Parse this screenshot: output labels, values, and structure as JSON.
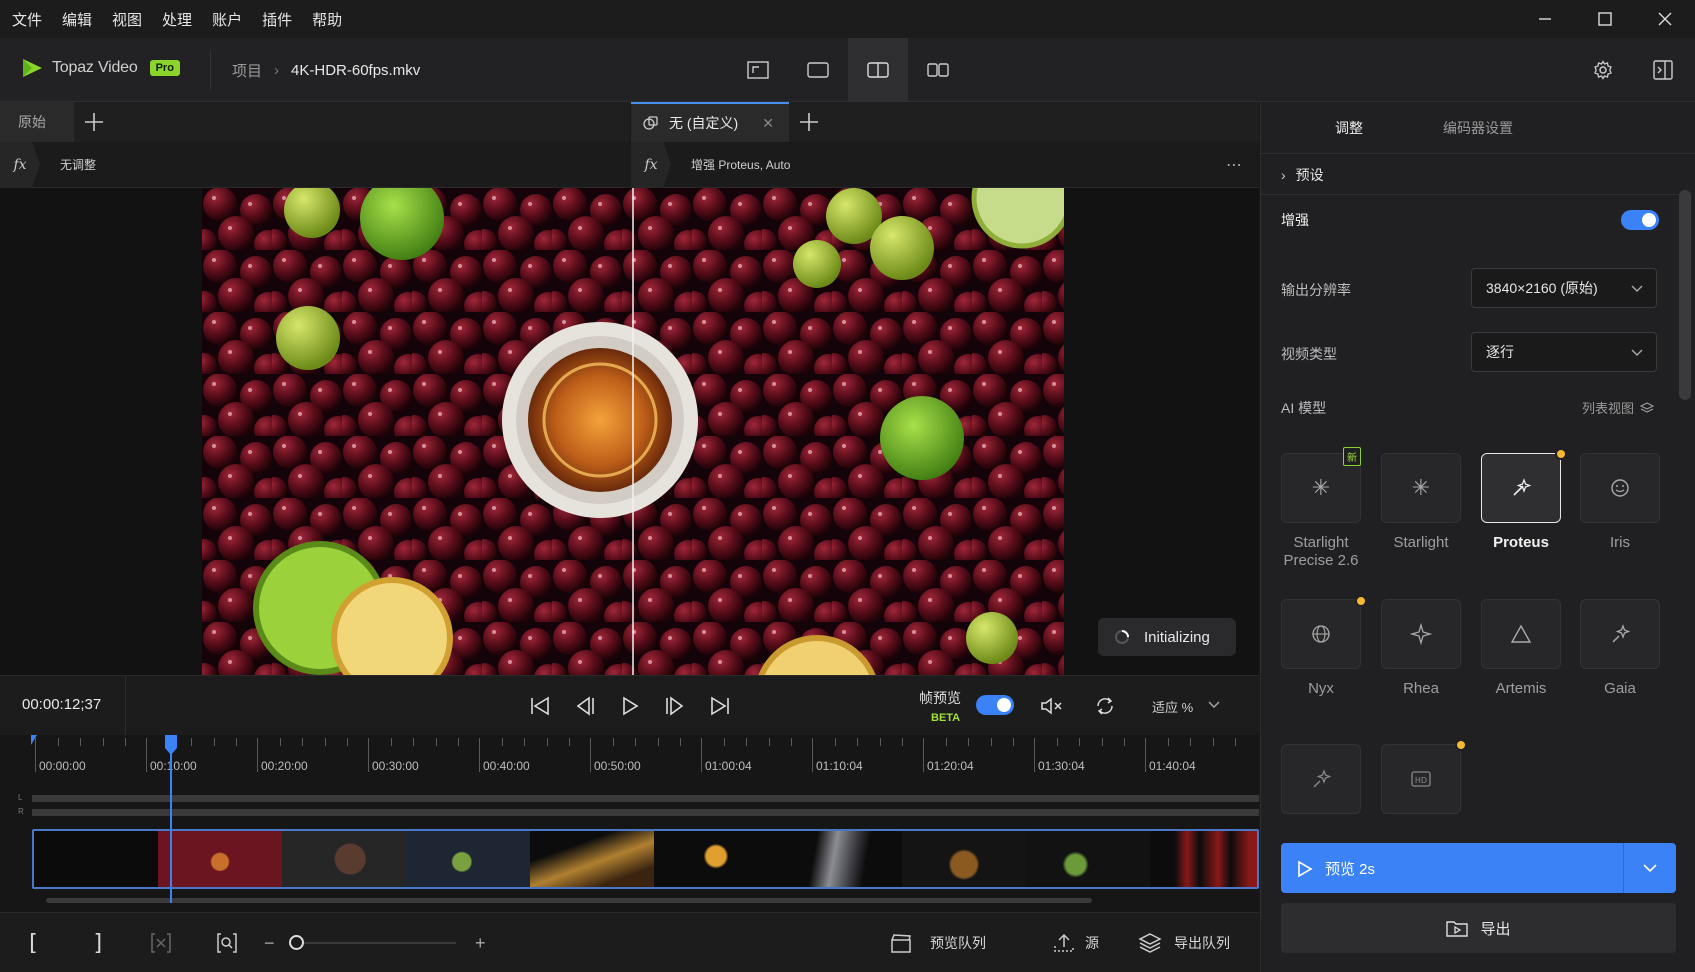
{
  "menu": [
    "文件",
    "编辑",
    "视图",
    "处理",
    "账户",
    "插件",
    "帮助"
  ],
  "app": {
    "brand": "Topaz Video",
    "badge": "Pro"
  },
  "breadcrumb": {
    "project": "项目",
    "file": "4K-HDR-60fps.mkv"
  },
  "left_panel": {
    "tab": "原始",
    "fx_label": "无调整"
  },
  "right_view": {
    "tab": "无 (自定义)",
    "fx_label": "增强 Proteus, Auto"
  },
  "status": {
    "initializing": "Initializing"
  },
  "transport": {
    "timecode": "00:00:12;37",
    "frame_preview_label": "帧预览",
    "beta": "BETA",
    "fit_label": "适应 %"
  },
  "timeline": {
    "labels": [
      "00:00:00",
      "00:10:00",
      "00:20:00",
      "00:30:00",
      "00:40:00",
      "00:50:00",
      "01:00:04",
      "01:10:04",
      "01:20:04",
      "01:30:04",
      "01:40:04"
    ],
    "channels": [
      "L",
      "R"
    ]
  },
  "bottombar": {
    "bracket_in": "[",
    "bracket_out": "]",
    "preview_queue": "预览队列",
    "source": "源",
    "export_queue": "导出队列"
  },
  "panel": {
    "tabs": [
      "调整",
      "编码器设置"
    ],
    "presets": "预设",
    "enhance": "增强",
    "resolution_label": "输出分辨率",
    "resolution_value": "3840×2160 (原始)",
    "video_type_label": "视频类型",
    "video_type_value": "逐行",
    "ai_model": "AI 模型",
    "list_view": "列表视图",
    "new_badge": "新",
    "models": [
      {
        "name": "Starlight Precise 2.6",
        "icon": "asterisk-icon"
      },
      {
        "name": "Starlight",
        "icon": "asterisk-icon"
      },
      {
        "name": "Proteus",
        "icon": "wand-icon"
      },
      {
        "name": "Iris",
        "icon": "face-icon"
      },
      {
        "name": "Nyx",
        "icon": "globe-icon"
      },
      {
        "name": "Rhea",
        "icon": "sparkle-icon"
      },
      {
        "name": "Artemis",
        "icon": "triangle-icon"
      },
      {
        "name": "Gaia",
        "icon": "pin-star-icon"
      }
    ],
    "preview_button": "预览 2s",
    "export_button": "导出"
  },
  "colors": {
    "accent": "#3b82f6",
    "pro_badge": "#8ad42b",
    "star": "#f5b82e"
  }
}
